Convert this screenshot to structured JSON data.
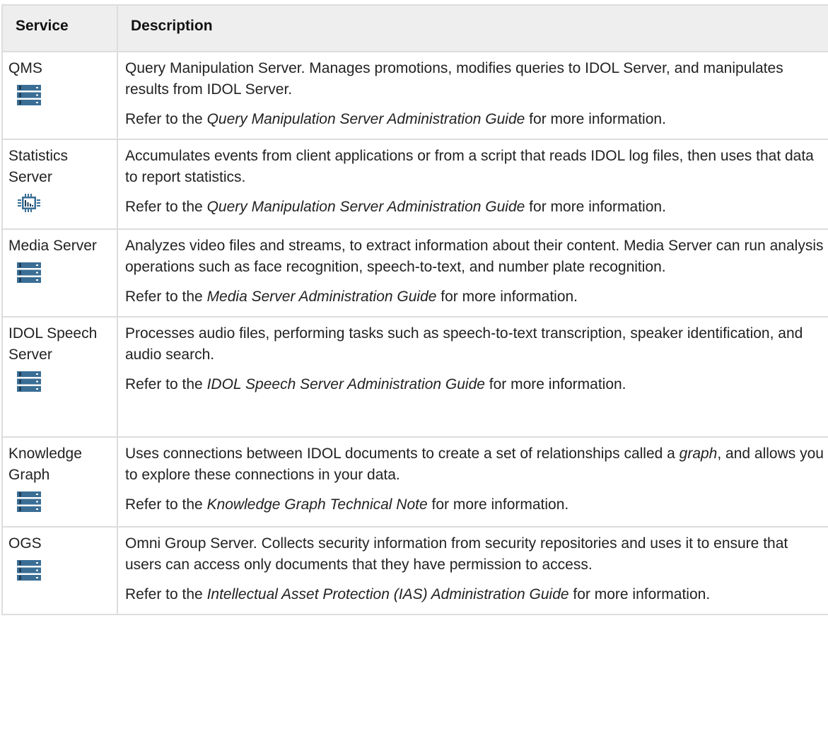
{
  "table": {
    "headers": {
      "service": "Service",
      "description": "Description"
    },
    "rows": [
      {
        "service": "QMS",
        "icon": "server-rack-icon",
        "description": "Query Manipulation Server. Manages promotions, modifies queries to IDOL Server, and manipulates results from IDOL Server.",
        "ref_prefix": "Refer to the ",
        "ref_title": "Query Manipulation Server Administration Guide",
        "ref_suffix": " for more information."
      },
      {
        "service": "Statistics Server",
        "icon": "chip-chart-icon",
        "description": "Accumulates events from client applications or from a script that reads IDOL log files, then uses that data to report statistics.",
        "ref_prefix": "Refer to the ",
        "ref_title": "Query Manipulation Server Administration Guide",
        "ref_suffix": " for more information."
      },
      {
        "service": "Media Server",
        "icon": "server-rack-icon",
        "description": "Analyzes video files and streams, to extract information about their content. Media Server can run analysis operations such as face recognition, speech-to-text, and number plate recognition.",
        "ref_prefix": "Refer to the ",
        "ref_title": "Media Server Administration Guide",
        "ref_suffix": " for more information."
      },
      {
        "service": "IDOL Speech Server",
        "icon": "server-rack-icon",
        "description": "Processes audio files, performing tasks such as speech-to-text transcription, speaker identification, and audio search.",
        "ref_prefix": "Refer to the ",
        "ref_title": "IDOL Speech Server Administration Guide",
        "ref_suffix": " for more information."
      },
      {
        "service": "Knowledge Graph",
        "icon": "server-rack-icon",
        "description_before": "Uses connections between IDOL documents to create a set of relationships called a ",
        "description_term": "graph",
        "description_after": ", and allows you to explore these connections in your data.",
        "ref_prefix": "Refer to the ",
        "ref_title": "Knowledge Graph Technical Note",
        "ref_suffix": " for more information."
      },
      {
        "service": "OGS",
        "icon": "server-rack-icon",
        "description": "Omni Group Server. Collects security information from security repositories and uses it to ensure that users can access only documents that they have permission to access.",
        "ref_prefix": "Refer to the ",
        "ref_title": "Intellectual Asset Protection (IAS) Administration Guide",
        "ref_suffix": " for more information."
      }
    ]
  },
  "colors": {
    "icon_blue": "#3a6e95",
    "icon_dark": "#1e3f5a",
    "header_bg": "#eeeeee",
    "border": "#dddddd"
  }
}
